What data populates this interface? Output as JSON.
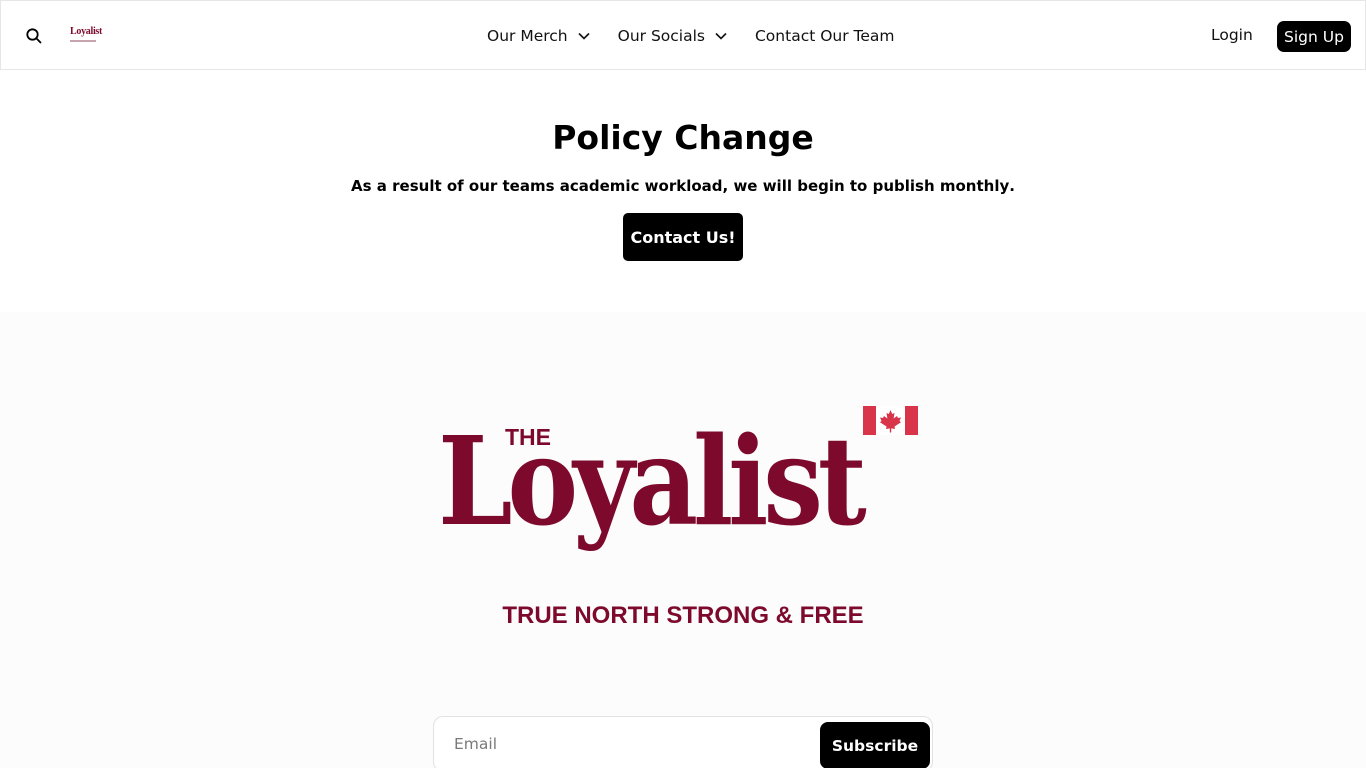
{
  "header": {
    "search_icon": "search-icon",
    "mini_logo_text": "Loyalist",
    "nav": [
      {
        "label": "Our Merch"
      },
      {
        "label": "Our Socials"
      },
      {
        "label": "Contact Our Team"
      }
    ],
    "login_label": "Login",
    "signup_label": "Sign Up"
  },
  "policy": {
    "title": "Policy Change",
    "text_before": "As a result of our teams academic workload, we will begin to publish ",
    "text_bold": "monthly",
    "text_after": ".",
    "button_label": "Contact Us!"
  },
  "hero": {
    "logo_the": "THE",
    "logo_word": "Loyalist",
    "tagline": "TRUE NORTH STRONG & FREE",
    "brand_color": "#7d0a2c",
    "flag_color": "#d8344a"
  },
  "subscribe": {
    "placeholder": "Email",
    "button_label": "Subscribe"
  }
}
